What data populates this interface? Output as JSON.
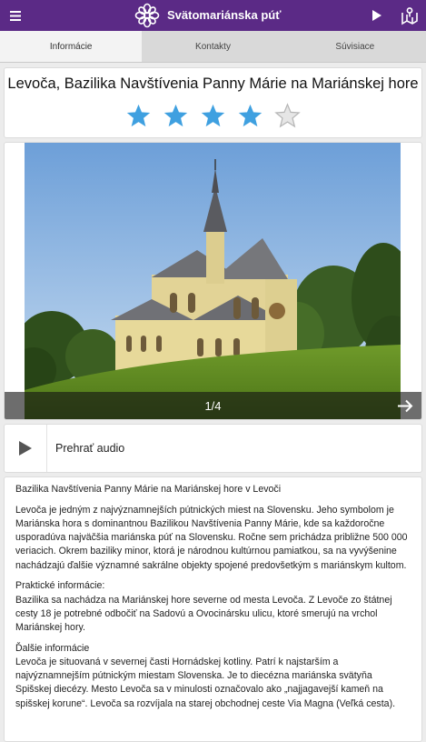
{
  "appbar": {
    "title": "Svätomariánska púť",
    "color": "#5b2a86",
    "menu_icon": "hamburger-icon",
    "play_icon": "play-icon",
    "map_icon": "map-icon"
  },
  "tabs": [
    {
      "label": "Informácie",
      "active": true
    },
    {
      "label": "Kontakty",
      "active": false
    },
    {
      "label": "Súvisiace",
      "active": false
    }
  ],
  "place": {
    "title": "Levoča, Bazilika Navštívenia Panny Márie na Mariánskej hore",
    "rating": 4,
    "rating_max": 5,
    "star_color": "#3fa0e0"
  },
  "gallery": {
    "counter": "1/4",
    "next_icon": "arrow-right-icon"
  },
  "audio": {
    "label": "Prehrať audio"
  },
  "article": {
    "heading": "Bazilika Navštívenia Panny Márie na Mariánskej hore v Levoči",
    "intro": "Levoča je jedným z najvýznamnejších pútnických miest na Slovensku. Jeho symbolom je Mariánska hora s dominantnou Bazilikou Navštívenia Panny Márie, kde sa každoročne usporadúva najväčšia mariánska púť na Slovensku. Ročne sem prichádza približne 500 000 veriacich. Okrem baziliky minor, ktorá je národnou kultúrnou pamiatkou, sa na vyvýšenine nachádzajú ďalšie významné sakrálne objekty spojené predovšetkým s mariánskym kultom.",
    "practical_heading": "Praktické informácie:",
    "practical_text": "Bazilika sa nachádza na Mariánskej hore severne od mesta Levoča. Z Levoče zo štátnej cesty 18 je potrebné odbočiť na Sadovú a Ovocinársku ulicu, ktoré smerujú na vrchol Mariánskej hory.",
    "more_heading": "Ďalšie informácie",
    "more_text": "Levoča je situovaná v severnej časti Hornádskej kotliny. Patrí k najstarším a najvýznamnejším pútnickým miestam Slovenska. Je to diecézna mariánska svätyňa Spišskej diecézy. Mesto Levoča sa v minulosti označovalo ako „najjagavejší kameň na spišskej korune“. Levoča sa rozvíjala na starej obchodnej ceste Via Magna (Veľká cesta)."
  }
}
